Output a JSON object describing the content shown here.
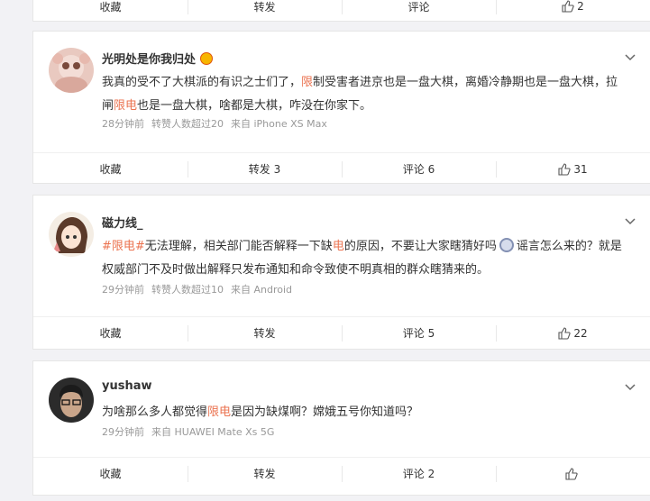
{
  "top_bar": {
    "collect": "收藏",
    "repost": "转发",
    "comment": "评论",
    "like_count": "2"
  },
  "posts": [
    {
      "author": "光明处是你我归处",
      "text_before": "我真的受不了大棋派的有识之士们了，",
      "text_hl1": "限",
      "text_mid": "制受害者进京也是一盘大棋，离婚冷静期也是一盘大棋，拉闸",
      "text_hl2": "限电",
      "text_after": "也是一盘大棋，啥都是大棋，咋没在你家下。",
      "time": "28分钟前",
      "repost_note": "转赞人数超过20",
      "source": "来自 iPhone XS Max",
      "collect": "收藏",
      "repost": "转发 3",
      "comment": "评论 6",
      "likes": "31"
    },
    {
      "author": "磁力线_",
      "tag": "#限电#",
      "text_a": "无法理解，相关部门能否解释一下缺",
      "text_hl": "电",
      "text_b": "的原因，不要让大家瞎猜好吗",
      "text_c": "谣言怎么来的？就是权威部门不及时做出解释只发布通知和命令致使不明真相的群众瞎猜来的。",
      "time": "29分钟前",
      "repost_note": "转赞人数超过10",
      "source": "来自 Android",
      "collect": "收藏",
      "repost": "转发",
      "comment": "评论 5",
      "likes": "22"
    },
    {
      "author": "yushaw",
      "text_before": "为啥那么多人都觉得",
      "text_hl": "限电",
      "text_after": "是因为缺煤啊？嫦娥五号你知道吗？",
      "time": "29分钟前",
      "source": "来自 HUAWEI Mate Xs 5G",
      "collect": "收藏",
      "repost": "转发",
      "comment": "评论 2"
    }
  ],
  "colors": {
    "highlight": "#eb7350",
    "meta": "#999999",
    "page_bg": "#f2f2f5"
  },
  "icons": [
    "like-icon",
    "chevron-down-icon",
    "crown-emoji-icon",
    "smiley-emoji-icon"
  ]
}
